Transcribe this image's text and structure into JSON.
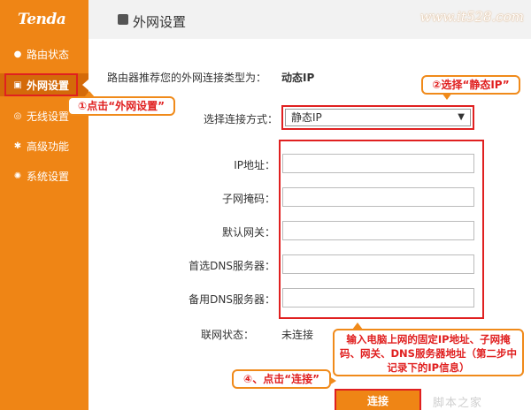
{
  "app": {
    "logo": "Tenda",
    "watermark": "www.it528.com",
    "watermark_bottom": "脚本之家"
  },
  "sidebar": {
    "items": [
      {
        "label": "路由状态",
        "icon": "●"
      },
      {
        "label": "外网设置",
        "icon": "▣",
        "active": true
      },
      {
        "label": "无线设置",
        "icon": "◎"
      },
      {
        "label": "高级功能",
        "icon": "✱"
      },
      {
        "label": "系统设置",
        "icon": "✺"
      }
    ]
  },
  "header": {
    "title": "外网设置"
  },
  "main": {
    "recommend_label": "路由器推荐您的外网连接类型为：",
    "recommend_value": "动态IP",
    "mode_label": "选择连接方式：",
    "mode_selected": "静态IP",
    "select_arrow": "▼",
    "fields": [
      {
        "label": "IP地址：",
        "value": ""
      },
      {
        "label": "子网掩码：",
        "value": ""
      },
      {
        "label": "默认网关：",
        "value": ""
      },
      {
        "label": "首选DNS服务器：",
        "value": ""
      },
      {
        "label": "备用DNS服务器：",
        "value": ""
      }
    ],
    "status_label": "联网状态：",
    "status_value": "未连接",
    "connect_button": "连接"
  },
  "callouts": {
    "step1": "①点击“外网设置”",
    "step2": "②选择“静态IP”",
    "step3": "输入电脑上网的固定IP地址、子网掩码、网关、DNS服务器地址（第二步中记录下的IP信息）",
    "step4": "④、点击“连接”"
  },
  "colors": {
    "accent": "#ef8515",
    "highlight": "#e02020"
  }
}
